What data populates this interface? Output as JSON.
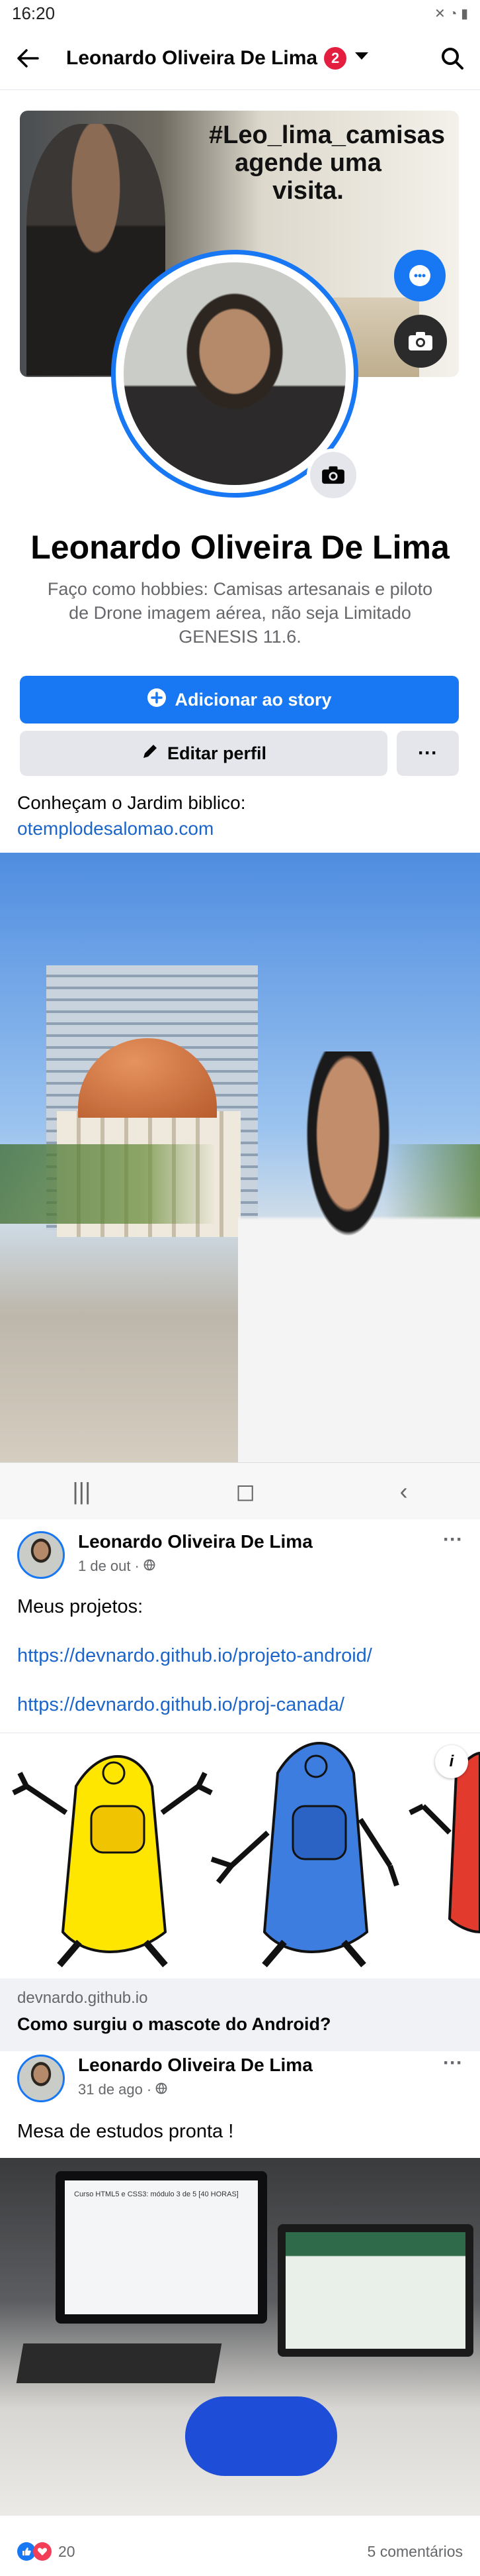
{
  "status_bar": {
    "time": "16:20",
    "icons": "✕ ◔ ▮"
  },
  "top_nav": {
    "title": "Leonardo Oliveira De Lima",
    "notification_count": "2"
  },
  "cover": {
    "caption": "#Leo_lima_camisas agende uma visita."
  },
  "profile": {
    "name": "Leonardo Oliveira De Lima",
    "bio": "Faço como hobbies: Camisas artesanais e piloto de Drone imagem aérea, não seja Limitado GENESIS 11.6.",
    "add_story_label": "Adicionar ao story",
    "edit_profile_label": "Editar perfil",
    "more_label": "···"
  },
  "featured": {
    "text": "Conheçam o Jardim biblico:",
    "link": "otemplodesalomao.com"
  },
  "nav_bar": {
    "recent": "|||",
    "home": "◻",
    "back": "‹"
  },
  "post1": {
    "author": "Leonardo Oliveira De Lima",
    "date": "1 de out",
    "text": "Meus projetos:",
    "link1": "https://devnardo.github.io/projeto-android/",
    "link2": "https://devnardo.github.io/proj-canada/",
    "preview_domain": "devnardo.github.io",
    "preview_title": "Como surgiu o mascote do Android?",
    "menu": "···"
  },
  "post2": {
    "author": "Leonardo Oliveira De Lima",
    "date": "31 de ago",
    "text": "Mesa de estudos pronta !",
    "monitor_text": "Curso HTML5 e CSS3: módulo 3 de 5 [40 HORAS]",
    "reaction_count": "20",
    "comments": "5 comentários",
    "menu": "···"
  },
  "colors": {
    "accent": "#1877f2",
    "badge": "#e41e3f",
    "link": "#1c65c9"
  }
}
